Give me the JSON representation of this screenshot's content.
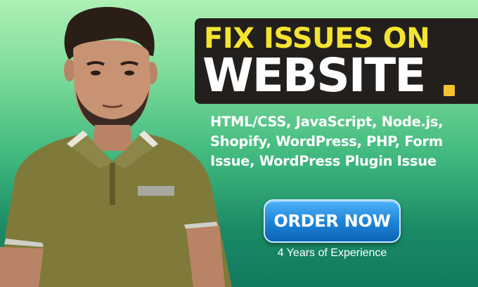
{
  "headline": {
    "line1": "FIX ISSUES ON",
    "line2": "WEBSITE",
    "accent_color": "#f4e431",
    "box_color": "#231f1c"
  },
  "skills": "HTML/CSS, JavaScript, Node.js, Shopify, WordPress, PHP, Form Issue, WordPress Plugin Issue",
  "cta": {
    "label": "ORDER NOW",
    "color": "#1f86db"
  },
  "experience": "4 Years of Experience",
  "photo": {
    "icon": "person-photo"
  }
}
